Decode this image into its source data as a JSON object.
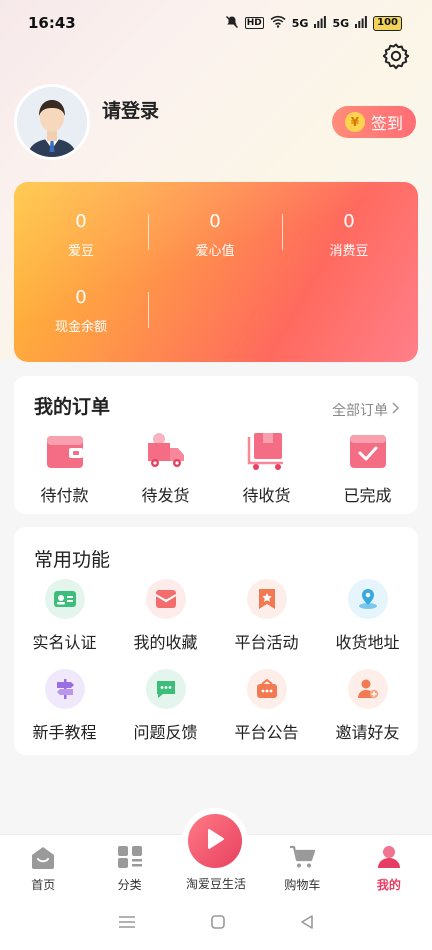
{
  "status_bar": {
    "time": "16:43",
    "net": "HD",
    "sig1": "5G",
    "sig2": "5G",
    "battery": "100"
  },
  "profile": {
    "login_text": "请登录",
    "checkin_label": "签到",
    "coin_symbol": "¥"
  },
  "assets": [
    {
      "value": "0",
      "label": "爱豆"
    },
    {
      "value": "0",
      "label": "爱心值"
    },
    {
      "value": "0",
      "label": "消费豆"
    },
    {
      "value": "0",
      "label": "现金余额"
    }
  ],
  "orders": {
    "title": "我的订单",
    "all_label": "全部订单",
    "items": [
      {
        "label": "待付款",
        "icon": "wallet-icon"
      },
      {
        "label": "待发货",
        "icon": "delivery-truck-icon"
      },
      {
        "label": "待收货",
        "icon": "package-cart-icon"
      },
      {
        "label": "已完成",
        "icon": "completed-box-icon"
      }
    ]
  },
  "functions": {
    "title": "常用功能",
    "items": [
      {
        "label": "实名认证",
        "icon": "id-card-icon",
        "color": "#e3f5ec"
      },
      {
        "label": "我的收藏",
        "icon": "favorite-icon",
        "color": "#fdecea"
      },
      {
        "label": "平台活动",
        "icon": "event-flag-icon",
        "color": "#fdeee9"
      },
      {
        "label": "收货地址",
        "icon": "location-icon",
        "color": "#e6f4fb"
      },
      {
        "label": "新手教程",
        "icon": "signpost-icon",
        "color": "#f0e9fb"
      },
      {
        "label": "问题反馈",
        "icon": "feedback-icon",
        "color": "#e3f5ec"
      },
      {
        "label": "平台公告",
        "icon": "announcement-icon",
        "color": "#fdeee9"
      },
      {
        "label": "邀请好友",
        "icon": "invite-friend-icon",
        "color": "#fdeee9"
      }
    ]
  },
  "tabbar": {
    "items": [
      {
        "label": "首页",
        "icon": "home-icon"
      },
      {
        "label": "分类",
        "icon": "category-icon"
      },
      {
        "label": "淘爱豆生活",
        "icon": "play-icon"
      },
      {
        "label": "购物车",
        "icon": "cart-icon"
      },
      {
        "label": "我的",
        "icon": "profile-icon"
      }
    ],
    "active": "我的"
  },
  "colors": {
    "accent": "#e73d63",
    "card_gradient_start": "#ffc030",
    "card_gradient_end": "#ff7f8a"
  }
}
